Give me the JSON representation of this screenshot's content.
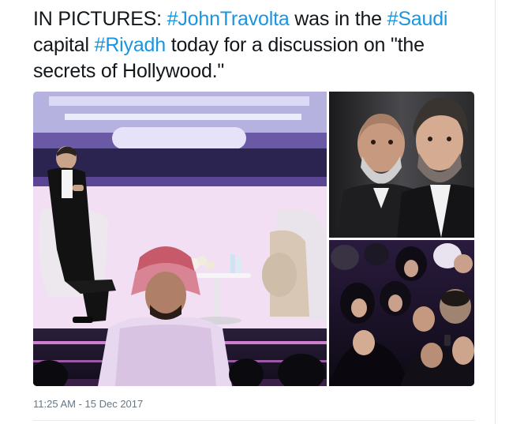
{
  "tweet": {
    "segments": [
      {
        "text": "IN PICTURES: ",
        "hashtag": false
      },
      {
        "text": "#JohnTravolta",
        "hashtag": true
      },
      {
        "text": " was in the ",
        "hashtag": false
      },
      {
        "text": "#Saudi",
        "hashtag": true
      },
      {
        "text": " capital ",
        "hashtag": false
      },
      {
        "text": "#Riyadh",
        "hashtag": true
      },
      {
        "text": " today for a discussion on \"the secrets of Hollywood.\"",
        "hashtag": false
      }
    ],
    "timestamp": "11:25 AM - 15 Dec 2017"
  },
  "colors": {
    "text": "#14171a",
    "hashtag": "#1b95e0",
    "meta": "#657786"
  },
  "media": {
    "count": 3,
    "photos": [
      {
        "name": "stage-discussion-photo"
      },
      {
        "name": "travolta-closeup-photo"
      },
      {
        "name": "audience-photo"
      }
    ]
  }
}
